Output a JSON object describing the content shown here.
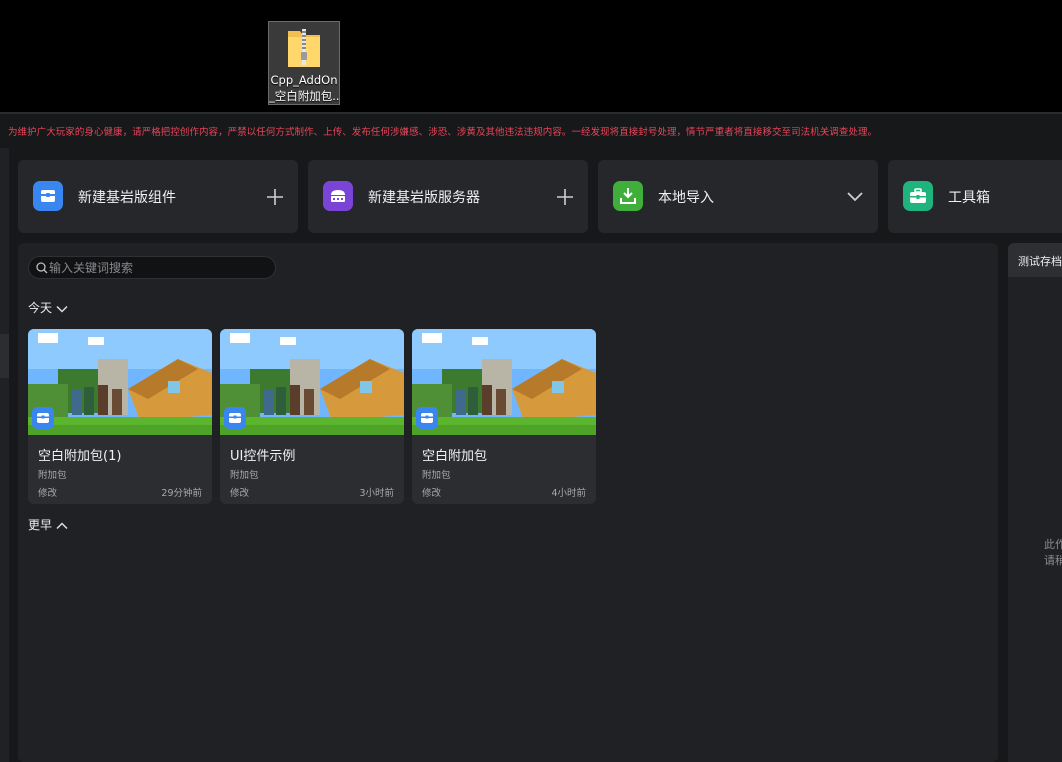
{
  "desktop": {
    "file_icon": "zip-folder-icon",
    "file_name_line1": "Cpp_AddOn",
    "file_name_line2": "_空白附加包..."
  },
  "app": {
    "warning": "为维护广大玩家的身心健康，请严格把控创作内容，严禁以任何方式制作、上传、发布任何涉嫌感、涉恐、涉黄及其他违法违规内容。一经发现将直接封号处理，情节严重者将直接移交至司法机关调查处理。",
    "actions": [
      {
        "label": "新建基岩版组件",
        "icon": "addon-box-icon",
        "trail": "plus-icon",
        "color": "#3a86f0"
      },
      {
        "label": "新建基岩版服务器",
        "icon": "server-chest-icon",
        "trail": "plus-icon",
        "color": "#7a45d6"
      },
      {
        "label": "本地导入",
        "icon": "download-icon",
        "trail": "chevron-down-icon",
        "color": "#3fae3a"
      },
      {
        "label": "工具箱",
        "icon": "toolbox-icon",
        "trail": "",
        "color": "#1fb37d"
      }
    ],
    "search": {
      "placeholder": "输入关键词搜索",
      "value": ""
    },
    "groups": {
      "today": "今天",
      "earlier": "更早"
    },
    "projects": [
      {
        "title": "空白附加包(1)",
        "type": "附加包",
        "modified_label": "修改",
        "time": "29分钟前"
      },
      {
        "title": "UI控件示例",
        "type": "附加包",
        "modified_label": "修改",
        "time": "3小时前"
      },
      {
        "title": "空白附加包",
        "type": "附加包",
        "modified_label": "修改",
        "time": "4小时前"
      }
    ],
    "right_panel": {
      "tab": "测试存档",
      "empty_line1": "此作",
      "empty_line2": "请稍"
    }
  }
}
